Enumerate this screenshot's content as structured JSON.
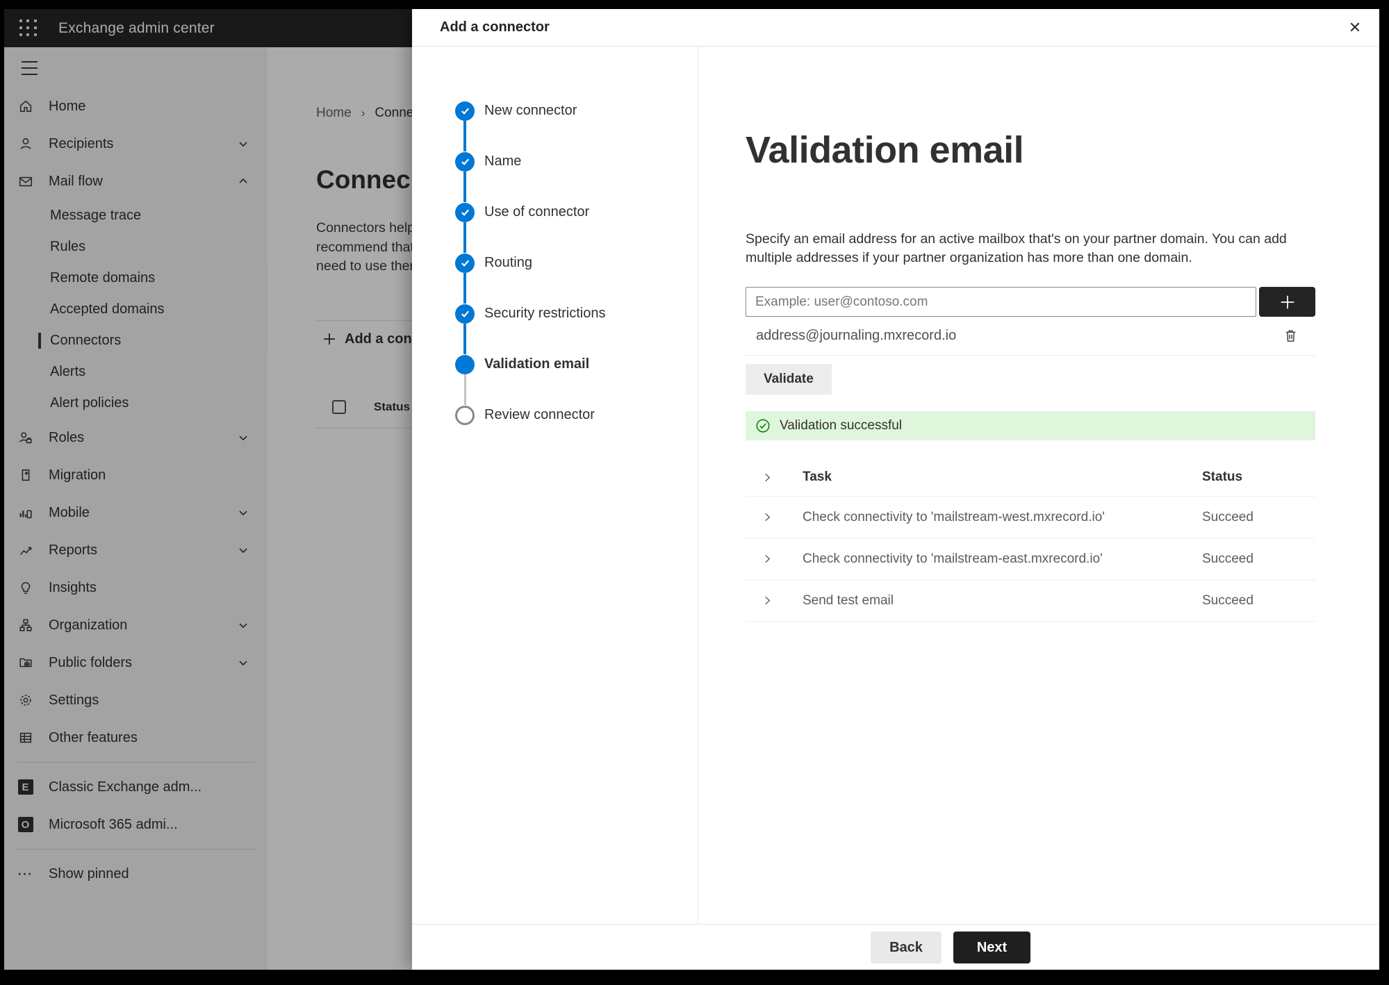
{
  "app_bar": {
    "title": "Exchange admin center"
  },
  "sidebar": {
    "items": [
      {
        "label": "Home"
      },
      {
        "label": "Recipients"
      },
      {
        "label": "Mail flow"
      },
      {
        "label": "Message trace"
      },
      {
        "label": "Rules"
      },
      {
        "label": "Remote domains"
      },
      {
        "label": "Accepted domains"
      },
      {
        "label": "Connectors"
      },
      {
        "label": "Alerts"
      },
      {
        "label": "Alert policies"
      },
      {
        "label": "Roles"
      },
      {
        "label": "Migration"
      },
      {
        "label": "Mobile"
      },
      {
        "label": "Reports"
      },
      {
        "label": "Insights"
      },
      {
        "label": "Organization"
      },
      {
        "label": "Public folders"
      },
      {
        "label": "Settings"
      },
      {
        "label": "Other features"
      },
      {
        "label": "Classic Exchange adm..."
      },
      {
        "label": "Microsoft 365 admi..."
      },
      {
        "label": "Show pinned"
      }
    ]
  },
  "background_page": {
    "breadcrumb": {
      "home": "Home",
      "current": "Conne"
    },
    "title": "Connec",
    "paragraph_lines": [
      "Connectors help",
      "recommend that",
      "need to use ther"
    ],
    "add_button_label": "Add a conn",
    "list_header_status": "Status"
  },
  "modal": {
    "title": "Add a connector",
    "steps": [
      {
        "label": "New connector",
        "state": "done"
      },
      {
        "label": "Name",
        "state": "done"
      },
      {
        "label": "Use of connector",
        "state": "done"
      },
      {
        "label": "Routing",
        "state": "done"
      },
      {
        "label": "Security restrictions",
        "state": "done"
      },
      {
        "label": "Validation email",
        "state": "current"
      },
      {
        "label": "Review connector",
        "state": "todo"
      }
    ],
    "content": {
      "heading": "Validation email",
      "description_line1": "Specify an email address for an active mailbox that's on your partner domain. You can add",
      "description_line2": "multiple addresses if your partner organization has more than one domain.",
      "email_input": {
        "value": "",
        "placeholder": "Example: user@contoso.com"
      },
      "addresses": [
        {
          "email": "address@journaling.mxrecord.io"
        }
      ],
      "validate_button": "Validate",
      "success_message": "Validation successful",
      "table": {
        "headers": {
          "task": "Task",
          "status": "Status"
        },
        "rows": [
          {
            "task": "Check connectivity to 'mailstream-west.mxrecord.io'",
            "status": "Succeed"
          },
          {
            "task": "Check connectivity to 'mailstream-east.mxrecord.io'",
            "status": "Succeed"
          },
          {
            "task": "Send test email",
            "status": "Succeed"
          }
        ]
      }
    },
    "footer": {
      "back": "Back",
      "next": "Next"
    }
  },
  "colors": {
    "accent": "#0078d4",
    "success_background": "#dff6dd",
    "success_green": "#107c10",
    "dark_button": "#1f1f1f"
  }
}
